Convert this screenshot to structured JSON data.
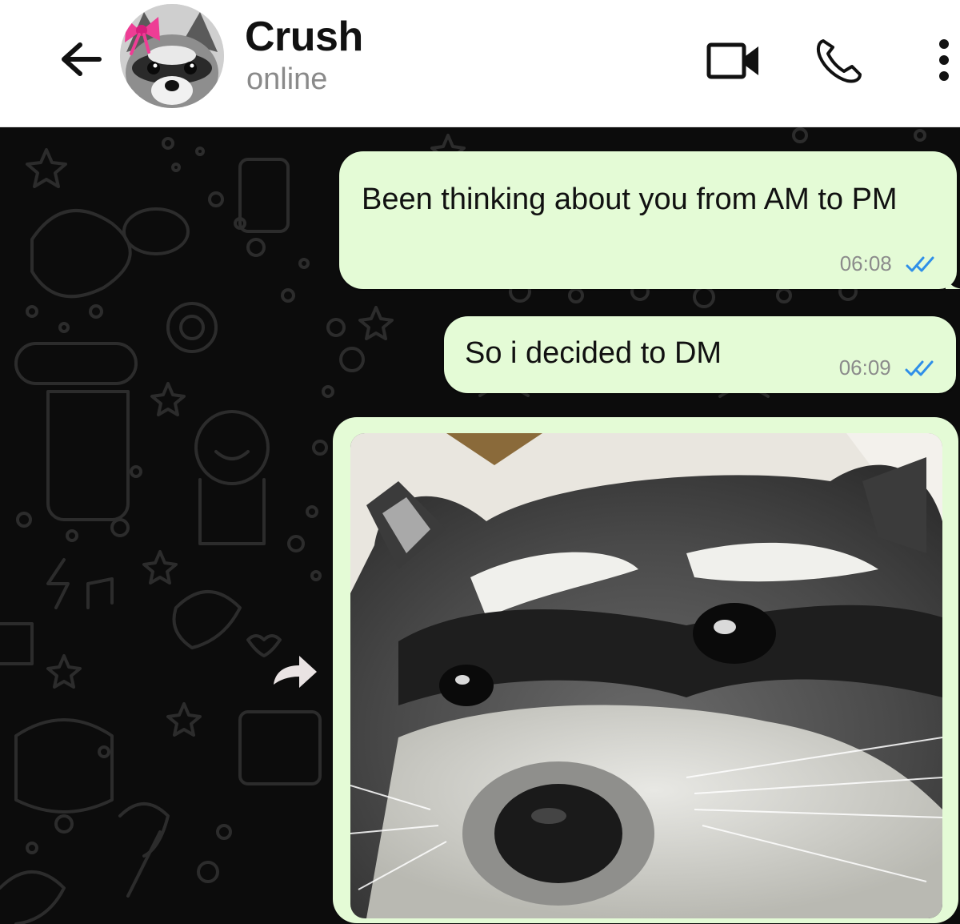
{
  "contact": {
    "name": "Crush",
    "status": "online",
    "avatar_icon": "raccoon-avatar-with-pink-bow"
  },
  "header_icons": {
    "back": "back-arrow-icon",
    "video": "video-camera-icon",
    "call": "phone-icon",
    "menu": "more-vertical-icon"
  },
  "messages": [
    {
      "text": "Been thinking about you from AM to PM",
      "time": "06:08",
      "status": "read",
      "direction": "outgoing"
    },
    {
      "text": "So i decided to DM",
      "time": "06:09",
      "status": "read",
      "direction": "outgoing"
    },
    {
      "type": "image",
      "image_icon": "raccoon-closeup-photo",
      "direction": "outgoing"
    }
  ],
  "colors": {
    "outgoing_bubble": "#e4fbd6",
    "read_ticks": "#2f8fe8",
    "chat_background": "#0c0c0c",
    "header_background": "#ffffff"
  }
}
